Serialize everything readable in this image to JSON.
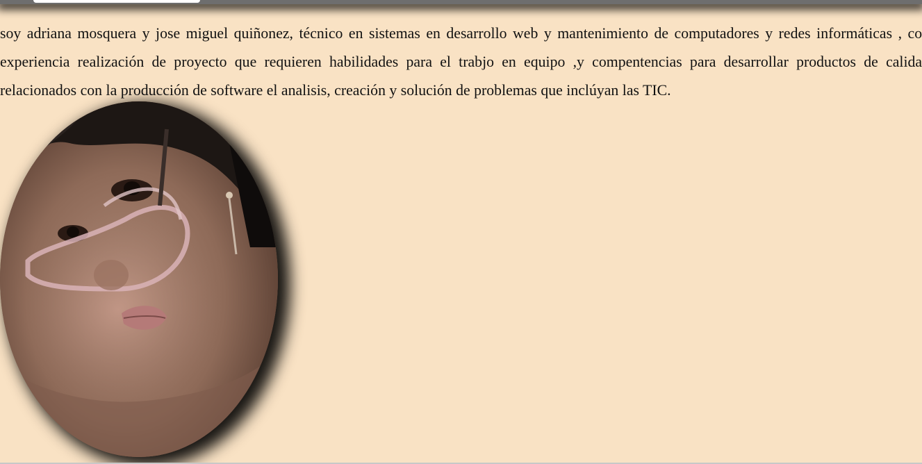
{
  "profile": {
    "bio_text": "soy adriana mosquera y jose miguel quiñonez, técnico en sistemas en desarrollo web y mantenimiento de computadores y redes informáticas , con experiencia realización de proyecto que requieren habilidades para el trabjo en equipo ,y compentencias para desarrollar productos de calidad relacionados con la producción de software el analisis, creación y solución de problemas que inclúyan las TIC."
  },
  "colors": {
    "page_background": "#f9e2c4",
    "text": "#111111",
    "top_bar": "#6e6e6e"
  },
  "icons": {
    "photo": "profile-photo"
  }
}
